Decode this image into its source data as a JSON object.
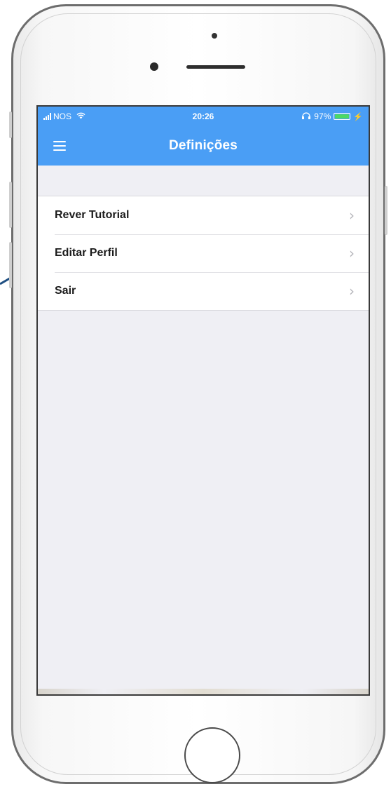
{
  "status_bar": {
    "carrier": "NOS",
    "time": "20:26",
    "battery_percent": "97%",
    "battery_level": 0.97,
    "battery_color": "#4cd964"
  },
  "nav": {
    "title": "Definições",
    "menu_icon": "hamburger-menu-icon",
    "bar_color": "#4a9ef5"
  },
  "settings": {
    "items": [
      {
        "label": "Rever Tutorial",
        "icon": "chevron-right-icon"
      },
      {
        "label": "Editar Perfil",
        "icon": "chevron-right-icon"
      },
      {
        "label": "Sair",
        "icon": "chevron-right-icon"
      }
    ]
  },
  "annotation": {
    "icon": "arrow-pointer-icon",
    "color": "#1f4f82"
  }
}
